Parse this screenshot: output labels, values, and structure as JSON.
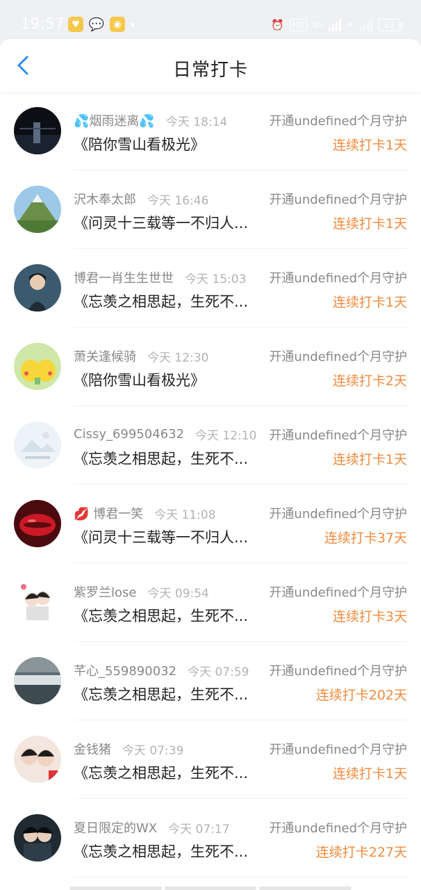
{
  "status_bar": {
    "time": "19:57",
    "network": "4G",
    "battery": "63"
  },
  "header": {
    "title": "日常打卡"
  },
  "colors": {
    "accent_blue": "#2f8bf0",
    "streak_orange": "#f08a3c"
  },
  "entries": [
    {
      "name": "烟雨迷离",
      "emoji_left": "💦",
      "emoji_right": "💦",
      "time": "今天 18:14",
      "guard": "开通undefined个月守护",
      "song": "《陪你雪山看极光》",
      "streak": "连续打卡1天"
    },
    {
      "name": "沢木奉太郎",
      "time": "今天 16:46",
      "guard": "开通undefined个月守护",
      "song": "《问灵十三载等一不归人...",
      "streak": "连续打卡1天"
    },
    {
      "name": "博君一肖生生世世",
      "time": "今天 15:03",
      "guard": "开通undefined个月守护",
      "song": "《忘羡之相思起，生死不...",
      "streak": "连续打卡1天"
    },
    {
      "name": "萧关逢候骑",
      "time": "今天 12:30",
      "guard": "开通undefined个月守护",
      "song": "《陪你雪山看极光》",
      "streak": "连续打卡2天"
    },
    {
      "name": "Cissy_699504632",
      "time": "今天 12:10",
      "guard": "开通undefined个月守护",
      "song": "《忘羡之相思起，生死不...",
      "streak": "连续打卡1天"
    },
    {
      "name": "博君一笑",
      "emoji_left": "💋",
      "time": "今天 11:08",
      "guard": "开通undefined个月守护",
      "song": "《问灵十三载等一不归人...",
      "streak": "连续打卡37天"
    },
    {
      "name": "紫罗兰lose",
      "time": "今天 09:54",
      "guard": "开通undefined个月守护",
      "song": "《忘羡之相思起，生死不...",
      "streak": "连续打卡3天"
    },
    {
      "name": "芊心_559890032",
      "time": "今天 07:59",
      "guard": "开通undefined个月守护",
      "song": "《忘羡之相思起，生死不...",
      "streak": "连续打卡202天"
    },
    {
      "name": "金钱猪",
      "time": "今天 07:39",
      "guard": "开通undefined个月守护",
      "song": "《忘羡之相思起，生死不...",
      "streak": "连续打卡1天"
    },
    {
      "name": "夏日限定的WX",
      "time": "今天 07:17",
      "guard": "开通undefined个月守护",
      "song": "《忘羡之相思起，生死不...",
      "streak": "连续打卡227天"
    }
  ]
}
